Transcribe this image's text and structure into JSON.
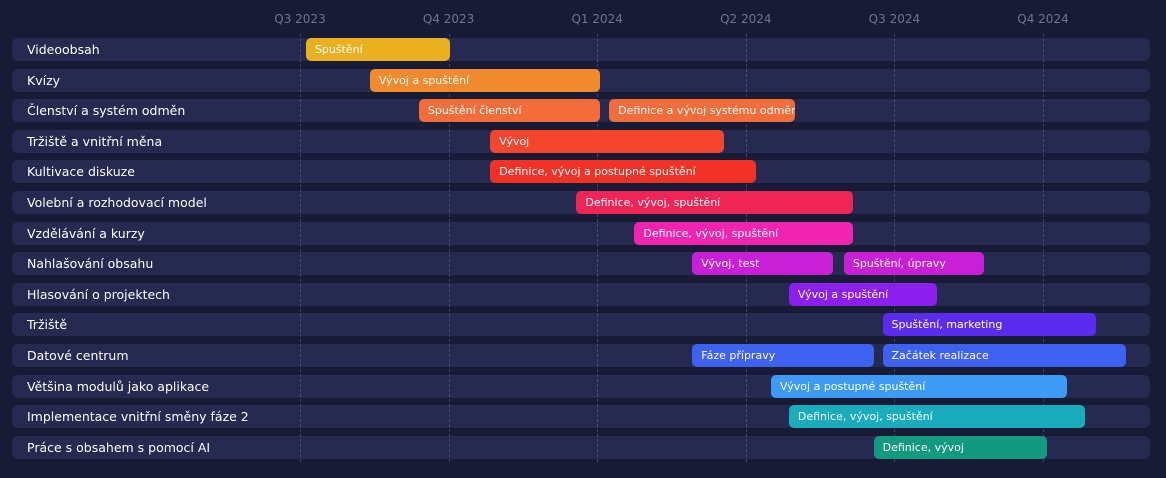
{
  "chart_data": {
    "type": "gantt",
    "quarters": [
      "Q3 2023",
      "Q4 2023",
      "Q1 2024",
      "Q2 2024",
      "Q3 2024",
      "Q4 2024"
    ],
    "rows": [
      {
        "label": "Videoobsah",
        "tasks": [
          {
            "label": "Spuštění",
            "start": 0.04,
            "end": 1.01,
            "color": "#ebb020"
          }
        ]
      },
      {
        "label": "Kvízy",
        "tasks": [
          {
            "label": "Vývoj a spuštění",
            "start": 0.47,
            "end": 2.02,
            "color": "#f18a2c"
          }
        ]
      },
      {
        "label": "Členství a systém odměn",
        "tasks": [
          {
            "label": "Spuštění členství",
            "start": 0.8,
            "end": 2.02,
            "color": "#f56c3b"
          },
          {
            "label": "Definice a vývoj systému odměn",
            "start": 2.08,
            "end": 3.33,
            "color": "#f56c3b"
          }
        ]
      },
      {
        "label": "Tržiště a vnitřní měna",
        "tasks": [
          {
            "label": "Vývoj",
            "start": 1.28,
            "end": 2.85,
            "color": "#f5452c"
          }
        ]
      },
      {
        "label": "Kultivace diskuze",
        "tasks": [
          {
            "label": "Definice, vývoj a postupné spuštění",
            "start": 1.28,
            "end": 3.07,
            "color": "#f33126"
          }
        ]
      },
      {
        "label": "Volební a rozhodovací model",
        "tasks": [
          {
            "label": "Definice, vývoj, spuštění",
            "start": 1.86,
            "end": 3.72,
            "color": "#f02456"
          }
        ]
      },
      {
        "label": "Vzdělávání a kurzy",
        "tasks": [
          {
            "label": "Definice, vývoj, spuštění",
            "start": 2.25,
            "end": 3.72,
            "color": "#f223b0"
          }
        ]
      },
      {
        "label": "Nahlašování obsahu",
        "tasks": [
          {
            "label": "Vývoj, test",
            "start": 2.64,
            "end": 3.59,
            "color": "#c81fd7"
          },
          {
            "label": "Spuštění, úpravy",
            "start": 3.66,
            "end": 4.6,
            "color": "#c81fd7"
          }
        ]
      },
      {
        "label": "Hlasování o projektech",
        "tasks": [
          {
            "label": "Vývoj a spuštění",
            "start": 3.29,
            "end": 4.29,
            "color": "#8d1ef0"
          }
        ]
      },
      {
        "label": "Tržiště",
        "tasks": [
          {
            "label": "Spuštění, marketing",
            "start": 3.92,
            "end": 5.36,
            "color": "#5b2cef"
          }
        ]
      },
      {
        "label": "Datové centrum",
        "tasks": [
          {
            "label": "Fáze přípravy",
            "start": 2.64,
            "end": 3.86,
            "color": "#3d62f0"
          },
          {
            "label": "Začátek realizace",
            "start": 3.92,
            "end": 5.56,
            "color": "#3d62f0"
          }
        ]
      },
      {
        "label": "Většina modulů jako aplikace",
        "tasks": [
          {
            "label": "Vývoj a postupné spuštění",
            "start": 3.17,
            "end": 5.16,
            "color": "#3d9bf5"
          }
        ]
      },
      {
        "label": "Implementace vnitřní směny fáze 2",
        "tasks": [
          {
            "label": "Definice, vývoj, spuštění",
            "start": 3.29,
            "end": 5.28,
            "color": "#18adbd"
          }
        ]
      },
      {
        "label": "Práce s obsahem s pomocí AI",
        "tasks": [
          {
            "label": "Definice, vývoj",
            "start": 3.86,
            "end": 5.03,
            "color": "#129a80"
          }
        ]
      }
    ]
  }
}
